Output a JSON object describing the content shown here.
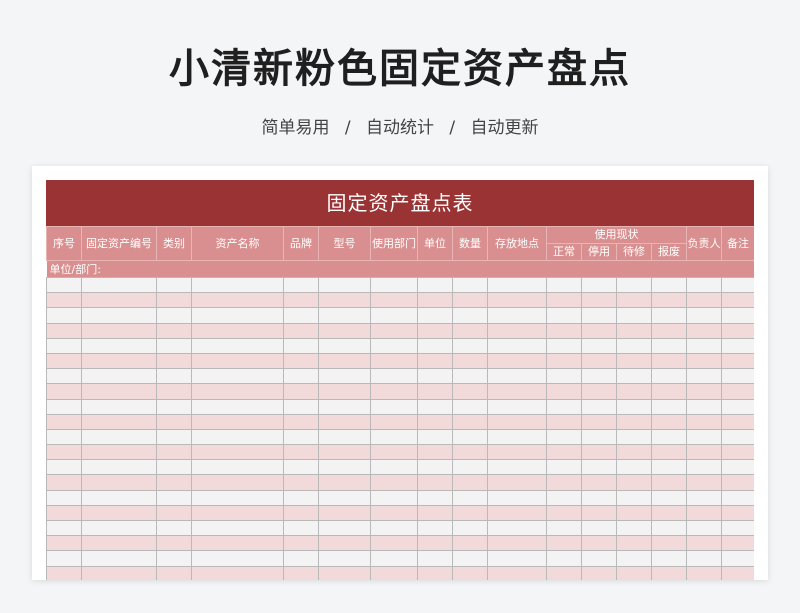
{
  "page": {
    "title": "小清新粉色固定资产盘点",
    "features": [
      "简单易用",
      "自动统计",
      "自动更新"
    ],
    "separator": "/"
  },
  "sheet": {
    "title": "固定资产盘点表",
    "unit_label": "单位/部门:",
    "headers": {
      "seq": "序号",
      "asset_code": "固定资产编号",
      "category": "类别",
      "asset_name": "资产名称",
      "brand": "品牌",
      "model": "型号",
      "department": "使用部门",
      "unit": "单位",
      "quantity": "数量",
      "location": "存放地点",
      "status_group": "使用现状",
      "status_normal": "正常",
      "status_stopped": "停用",
      "status_repair": "待修",
      "status_scrapped": "报废",
      "owner": "负责人",
      "remark": "备注"
    },
    "row_count": 20,
    "colors": {
      "title_band": "#9a3333",
      "header_bg": "#d98f8f",
      "row_odd": "#f3f3f3",
      "row_even": "#f2dada"
    }
  }
}
